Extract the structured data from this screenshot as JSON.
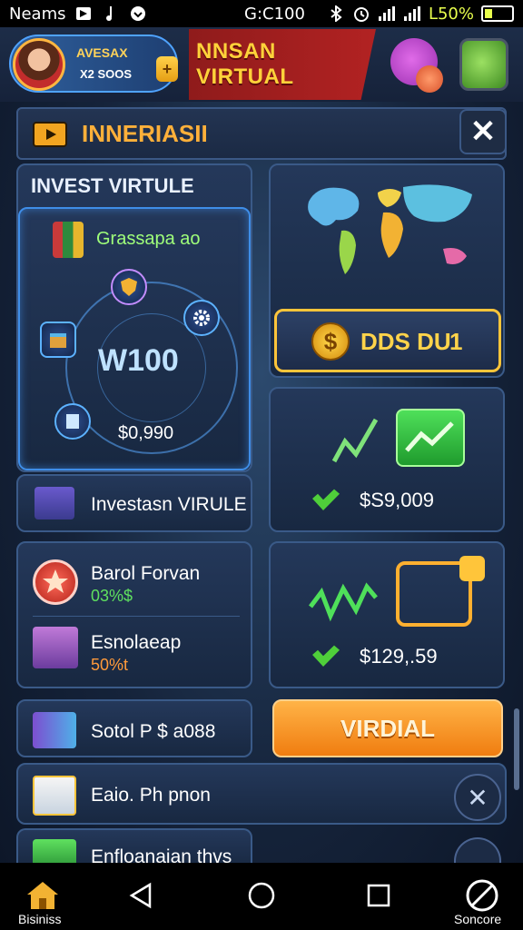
{
  "status_bar": {
    "carrier": "Neams",
    "time": "G:C100",
    "battery_pct": "L50%"
  },
  "profile": {
    "name": "AVESAX",
    "sub": "X2 SOOS",
    "plus": "+"
  },
  "banner": {
    "title": "NNSAN VIRTUAL"
  },
  "panel": {
    "title": "INNERIASII",
    "close": "✕"
  },
  "invest": {
    "label": "INVEST VIRTULE",
    "growth_label": "Grassapa ao",
    "center_value": "W100",
    "sub_value": "$0,990"
  },
  "invest_row": {
    "label": "Investasn VIRULE"
  },
  "list_a": [
    {
      "title": "Barol Forvan",
      "sub": "03%$"
    },
    {
      "title": "Esnolaeap",
      "sub": "50%t"
    }
  ],
  "coin_bar": {
    "coin": "$",
    "text": "DDS DU",
    "count": "1"
  },
  "stock_card_1": {
    "price": "$S9,009"
  },
  "stock_card_2": {
    "price": "$129,.59"
  },
  "cards_bottom": [
    {
      "label": "Sotol P $ a088"
    },
    {
      "label": "Eaio. Ph pnon"
    },
    {
      "label": "Enfloanaian thvs"
    }
  ],
  "action_button": {
    "label": "VIRDIAL"
  },
  "close_circle": {
    "label": "✕"
  },
  "nav": {
    "home_label": "Bisiniss",
    "right_label": "Soncore"
  }
}
